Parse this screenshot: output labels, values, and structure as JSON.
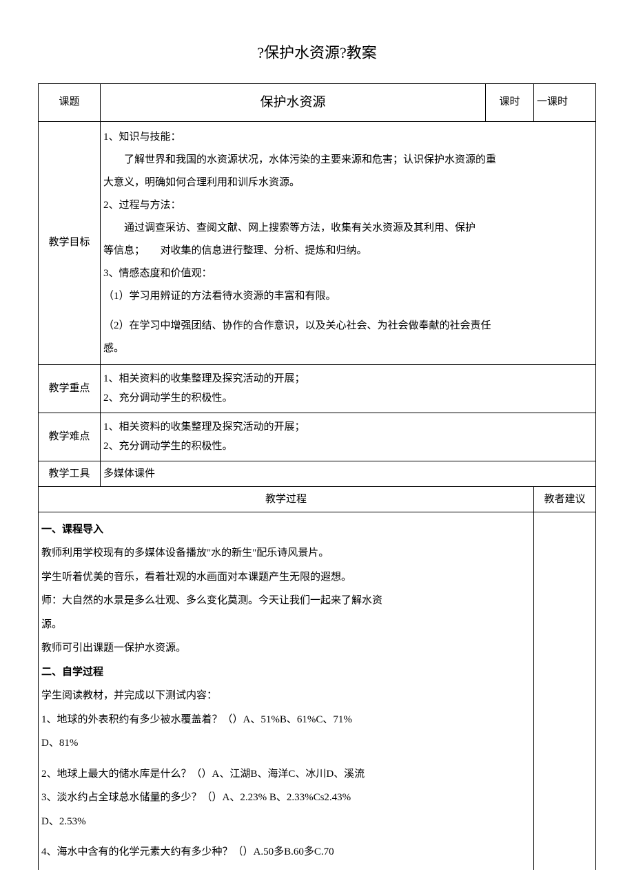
{
  "title": "?保护水资源?教案",
  "row1": {
    "kt_label": "课题",
    "kt_value": "保护水资源",
    "ks_label": "课时",
    "ks_value": "一课时"
  },
  "goals": {
    "label": "教学目标",
    "l1": "1、知识与技能：",
    "l2": "了解世界和我国的水资源状况，水体污染的主要来源和危害；认识保护水资源的重",
    "l3": "大意义，明确如何合理利用和训斥水资源。",
    "l4": "2、过程与方法：",
    "l5": "通过调查采访、查阅文献、网上搜索等方法，收集有关水资源及其利用、保护",
    "l6a": "等信息；",
    "l6b": "对收集的信息进行整理、分析、提炼和归纳。",
    "l7": "3、情感态度和价值观：",
    "l8": "（1）学习用辨证的方法看待水资源的丰富和有限。",
    "l9": "（2）在学习中增强团结、协作的合作意识，以及关心社会、为社会做奉献的社会责任",
    "l10": "感。"
  },
  "keypoint": {
    "label": "教学重点",
    "l1": "1、相关资料的收集整理及探究活动的开展；",
    "l2": "2、充分调动学生的积极性。"
  },
  "difficulty": {
    "label": "教学难点",
    "l1": "1、相关资料的收集整理及探究活动的开展；",
    "l2": "2、充分调动学生的积极性。"
  },
  "tools": {
    "label": "教学工具",
    "value": "多媒体课件"
  },
  "process_header": {
    "left": "教学过程",
    "right": "教者建议"
  },
  "process": {
    "s1": "一、课程导入",
    "p1": "教师利用学校现有的多媒体设备播放\"水的新生\"配乐诗风景片。",
    "p2": "学生听着优美的音乐，看着壮观的水画面对本课题产生无限的遐想。",
    "p3": "师：大自然的水景是多么壮观、多么变化莫测。今天让我们一起来了解水资",
    "p3b": "源。",
    "p4": "教师可引出课题一保护水资源。",
    "s2": "二、自学过程",
    "p5": "学生阅读教材，并完成以下测试内容：",
    "q1a": "1、地球的外表积约有多少被水覆盖着？（）A、51%B、61%C、71%",
    "q1b": "D、81%",
    "q2": "2、地球上最大的储水库是什么？（）A、江湖B、海洋C、冰川D、溪流",
    "q3a": "3、淡水约占全球总水储量的多少？（）A、2.23%  B、2.33%Cs2.43%",
    "q3b": "D、2.53%",
    "q4": "4、海水中含有的化学元素大约有多少种？（）A.50多B.60多C.70"
  }
}
